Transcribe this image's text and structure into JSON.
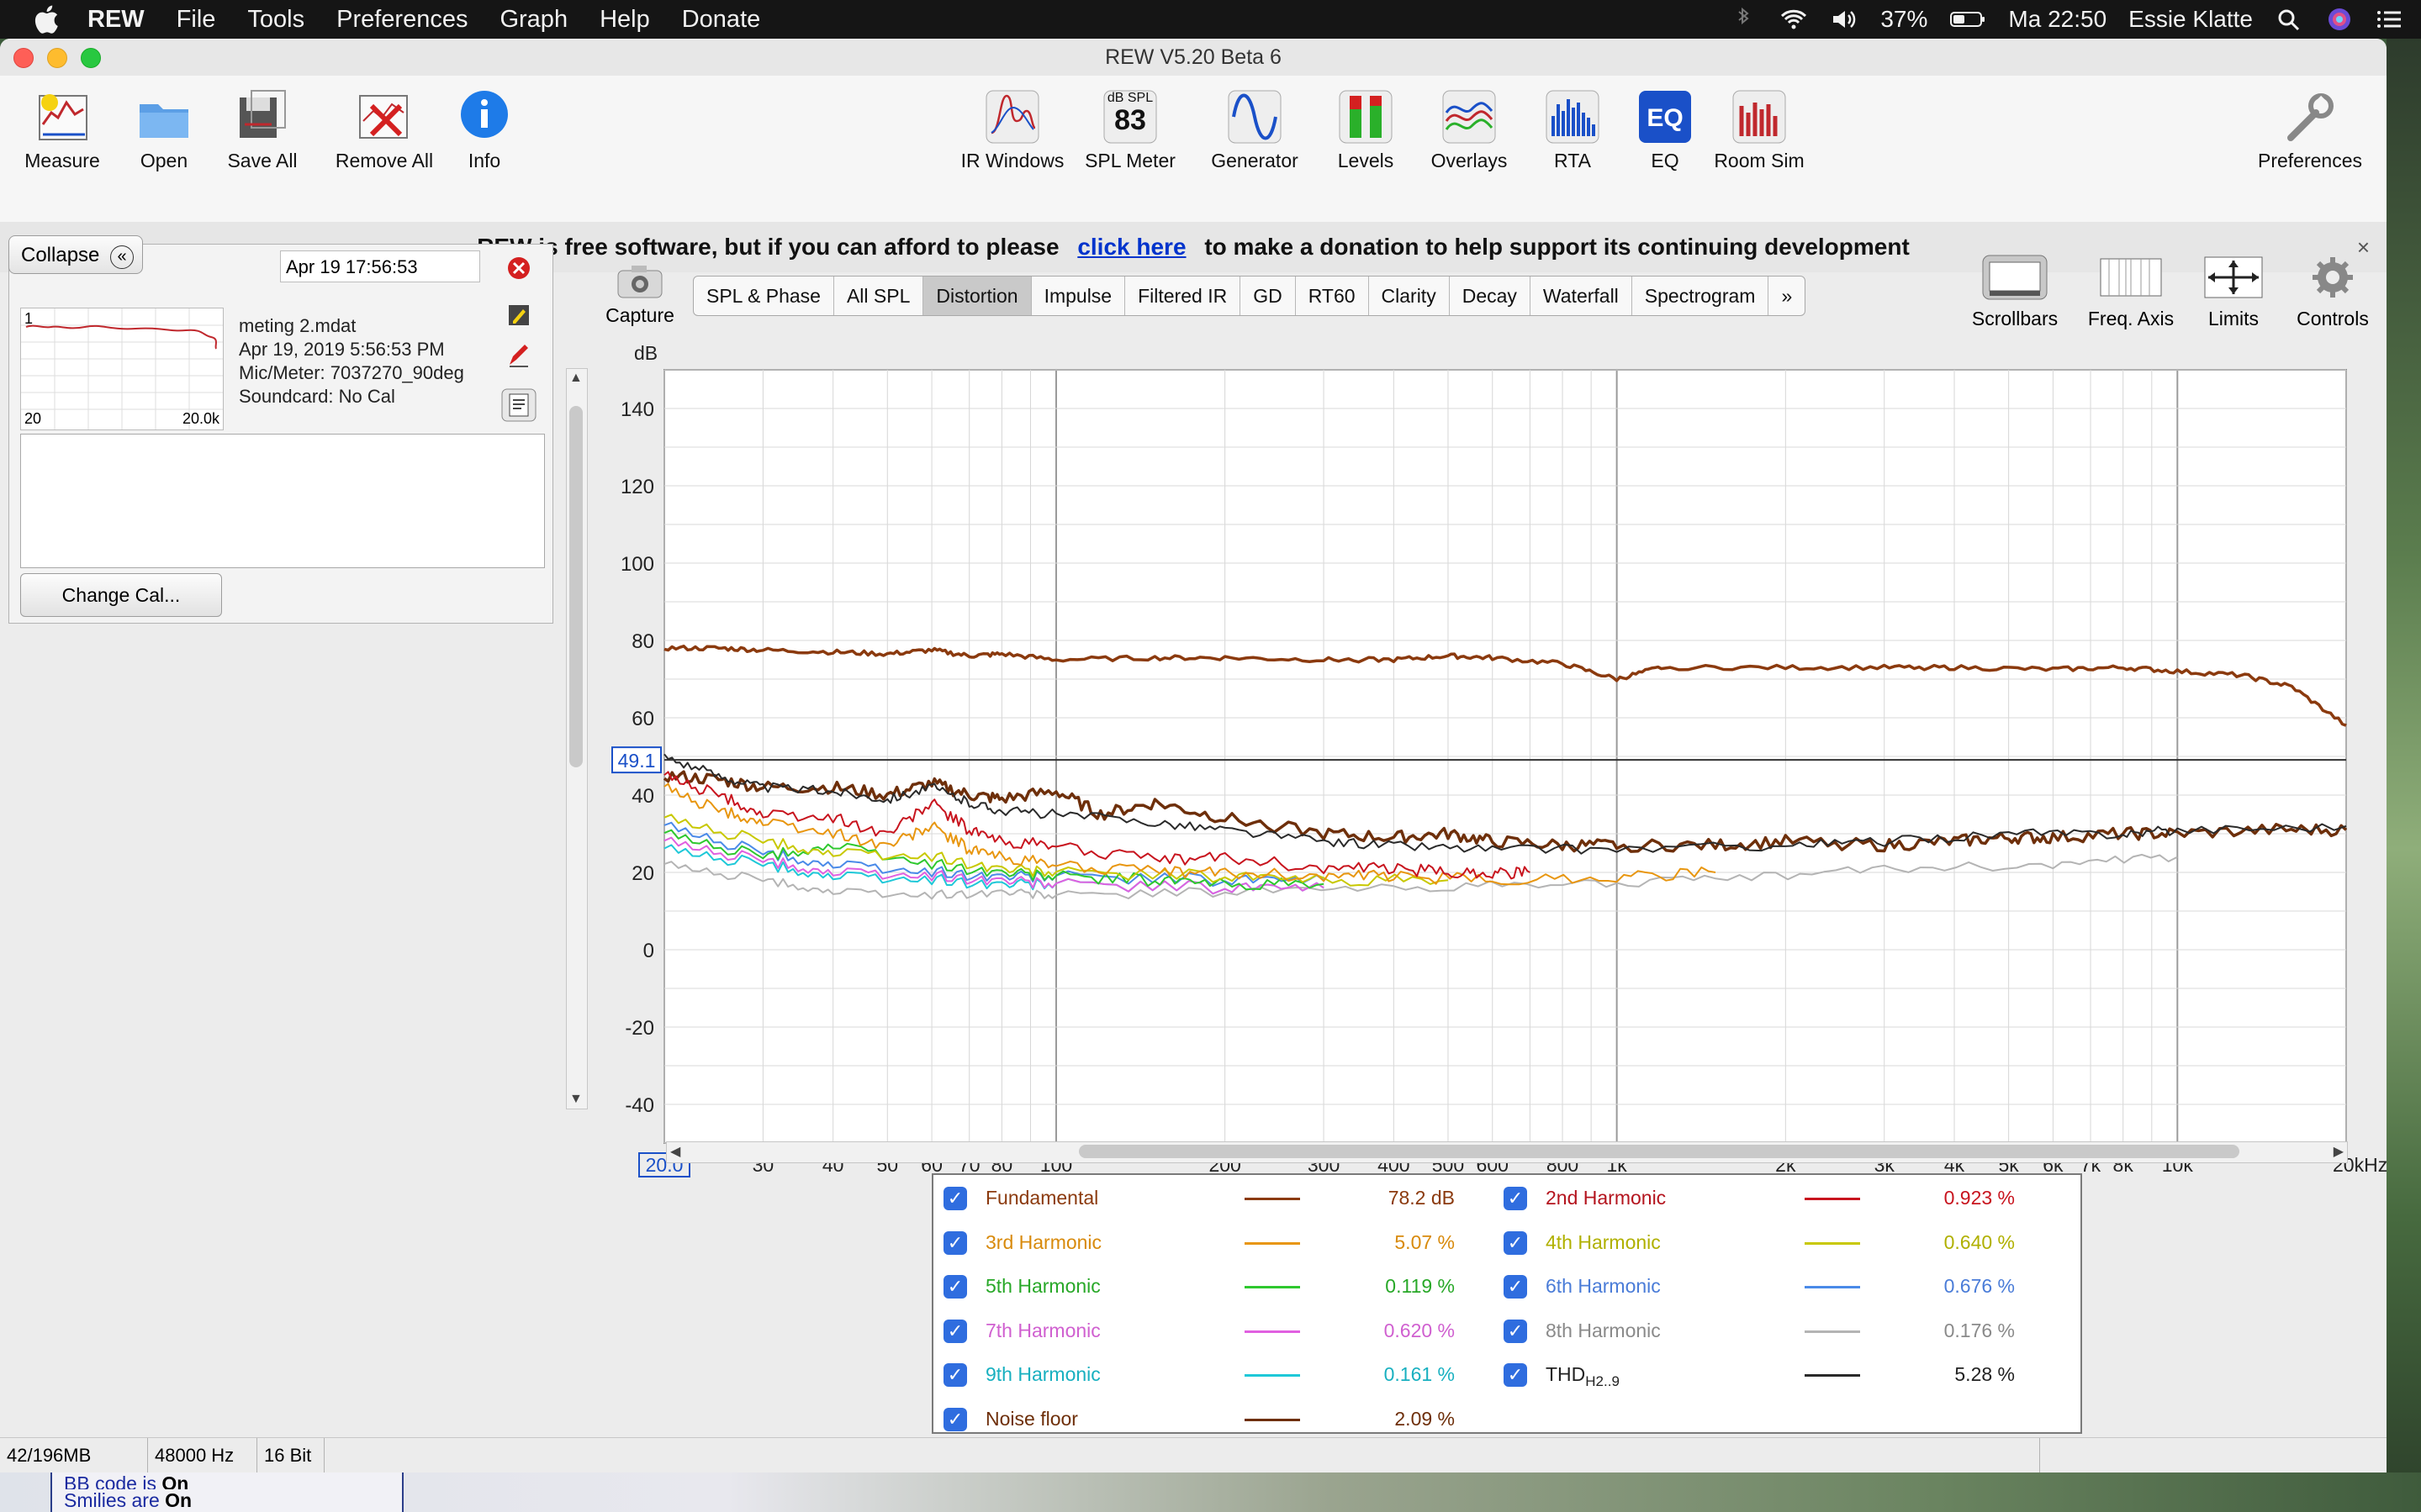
{
  "menubar": {
    "app": "REW",
    "items": [
      "File",
      "Tools",
      "Preferences",
      "Graph",
      "Help",
      "Donate"
    ],
    "battery": "37%",
    "clock": "Ma 22:50",
    "user": "Essie Klatte"
  },
  "window": {
    "title": "REW V5.20 Beta 6"
  },
  "toolbar": {
    "measure": "Measure",
    "open": "Open",
    "save_all": "Save All",
    "remove_all": "Remove All",
    "info": "Info",
    "ir_windows": "IR Windows",
    "spl_meter": "SPL Meter",
    "spl_badge_top": "dB SPL",
    "spl_badge_val": "83",
    "generator": "Generator",
    "levels": "Levels",
    "overlays": "Overlays",
    "rta": "RTA",
    "eq": "EQ",
    "room_sim": "Room Sim",
    "preferences": "Preferences"
  },
  "donate_bar": {
    "before": "REW is free software, but if you can afford to please",
    "link": "click here",
    "after": "to make a donation to help support its continuing development",
    "close": "×"
  },
  "left_panel": {
    "collapse": "Collapse",
    "date_field": "Apr 19 17:56:53",
    "thumb_index": "1",
    "thumb_x_min": "20",
    "thumb_x_max": "20.0k",
    "file": "meting 2.mdat",
    "date": "Apr 19, 2019 5:56:53 PM",
    "mic": "Mic/Meter: 7037270_90deg",
    "soundcard": "Soundcard: No Cal",
    "change_cal": "Change Cal..."
  },
  "graph_tabs": {
    "capture": "Capture",
    "tabs": [
      "SPL & Phase",
      "All SPL",
      "Distortion",
      "Impulse",
      "Filtered IR",
      "GD",
      "RT60",
      "Clarity",
      "Decay",
      "Waterfall",
      "Spectrogram",
      "»"
    ],
    "active": "Distortion",
    "scrollbars": "Scrollbars",
    "freq_axis": "Freq. Axis",
    "limits": "Limits",
    "controls": "Controls"
  },
  "chart_data": {
    "type": "line",
    "ylabel": "dB",
    "xlabel": "",
    "x_scale": "log",
    "xlim": [
      20,
      20000
    ],
    "ylim": [
      -50,
      150
    ],
    "y_ticks": [
      140,
      120,
      100,
      80,
      60,
      40,
      20,
      0,
      -20,
      -40
    ],
    "x_ticks": [
      {
        "v": 20,
        "t": "20.0"
      },
      {
        "v": 30,
        "t": "30"
      },
      {
        "v": 40,
        "t": "40"
      },
      {
        "v": 50,
        "t": "50"
      },
      {
        "v": 60,
        "t": "60"
      },
      {
        "v": 70,
        "t": "70"
      },
      {
        "v": 80,
        "t": "80"
      },
      {
        "v": 100,
        "t": "100"
      },
      {
        "v": 200,
        "t": "200"
      },
      {
        "v": 300,
        "t": "300"
      },
      {
        "v": 400,
        "t": "400"
      },
      {
        "v": 500,
        "t": "500"
      },
      {
        "v": 600,
        "t": "600"
      },
      {
        "v": 800,
        "t": "800"
      },
      {
        "v": 1000,
        "t": "1k"
      },
      {
        "v": 2000,
        "t": "2k"
      },
      {
        "v": 3000,
        "t": "3k"
      },
      {
        "v": 4000,
        "t": "4k"
      },
      {
        "v": 5000,
        "t": "5k"
      },
      {
        "v": 6000,
        "t": "6k"
      },
      {
        "v": 7000,
        "t": "7k"
      },
      {
        "v": 8000,
        "t": "8k"
      },
      {
        "v": 10000,
        "t": "10k"
      },
      {
        "v": 20000,
        "t": "20kHz"
      }
    ],
    "cursor_level": 49.1,
    "cursor_label": "49.1",
    "series": [
      {
        "name": "Fundamental",
        "color": "#8b3a0e",
        "points": [
          [
            20,
            78
          ],
          [
            25,
            78
          ],
          [
            30,
            77.5
          ],
          [
            40,
            77
          ],
          [
            50,
            76.5
          ],
          [
            60,
            77.5
          ],
          [
            70,
            76
          ],
          [
            80,
            76.5
          ],
          [
            100,
            75
          ],
          [
            150,
            75.5
          ],
          [
            200,
            75.5
          ],
          [
            300,
            75
          ],
          [
            400,
            75
          ],
          [
            500,
            76
          ],
          [
            600,
            75.5
          ],
          [
            800,
            74
          ],
          [
            1000,
            70
          ],
          [
            1200,
            73
          ],
          [
            2000,
            73
          ],
          [
            3000,
            73
          ],
          [
            4000,
            73
          ],
          [
            6000,
            72.5
          ],
          [
            8000,
            73
          ],
          [
            10000,
            72
          ],
          [
            13000,
            71
          ],
          [
            16000,
            68
          ],
          [
            20000,
            58
          ]
        ]
      },
      {
        "name": "2nd Harmonic",
        "color": "#c8141e",
        "points": [
          [
            20,
            45
          ],
          [
            25,
            40
          ],
          [
            30,
            35
          ],
          [
            40,
            34
          ],
          [
            50,
            30
          ],
          [
            60,
            38
          ],
          [
            70,
            31
          ],
          [
            80,
            28
          ],
          [
            100,
            27
          ],
          [
            150,
            23
          ],
          [
            200,
            24
          ],
          [
            300,
            21
          ],
          [
            400,
            21
          ],
          [
            500,
            20
          ],
          [
            600,
            20
          ],
          [
            700,
            20
          ]
        ]
      },
      {
        "name": "3rd Harmonic",
        "color": "#e8960f",
        "points": [
          [
            20,
            42
          ],
          [
            25,
            36
          ],
          [
            30,
            33
          ],
          [
            40,
            30
          ],
          [
            50,
            27
          ],
          [
            60,
            32
          ],
          [
            70,
            26
          ],
          [
            80,
            24
          ],
          [
            100,
            22
          ],
          [
            150,
            20
          ],
          [
            200,
            20
          ],
          [
            300,
            19
          ],
          [
            400,
            19
          ],
          [
            600,
            18
          ],
          [
            1000,
            19
          ],
          [
            1500,
            20
          ]
        ]
      },
      {
        "name": "4th Harmonic",
        "color": "#c8c800",
        "points": [
          [
            20,
            34
          ],
          [
            30,
            28
          ],
          [
            40,
            25
          ],
          [
            60,
            24
          ],
          [
            80,
            21
          ],
          [
            100,
            20
          ],
          [
            200,
            19
          ],
          [
            300,
            18
          ],
          [
            500,
            18
          ]
        ]
      },
      {
        "name": "5th Harmonic",
        "color": "#2ec82e",
        "points": [
          [
            20,
            30
          ],
          [
            30,
            24
          ],
          [
            40,
            27
          ],
          [
            60,
            22
          ],
          [
            80,
            20
          ],
          [
            100,
            19
          ],
          [
            150,
            18
          ],
          [
            200,
            17
          ],
          [
            300,
            17
          ]
        ]
      },
      {
        "name": "6th Harmonic",
        "color": "#4a8ae8",
        "points": [
          [
            20,
            32
          ],
          [
            30,
            25
          ],
          [
            40,
            22
          ],
          [
            60,
            20
          ],
          [
            80,
            19
          ],
          [
            100,
            19
          ],
          [
            200,
            18
          ],
          [
            300,
            18
          ]
        ]
      },
      {
        "name": "7th Harmonic",
        "color": "#e060e0",
        "points": [
          [
            20,
            28
          ],
          [
            30,
            23
          ],
          [
            40,
            20
          ],
          [
            60,
            19
          ],
          [
            80,
            18
          ],
          [
            100,
            17
          ],
          [
            200,
            16
          ],
          [
            300,
            16
          ]
        ]
      },
      {
        "name": "8th Harmonic",
        "color": "#b4b4b4",
        "points": [
          [
            20,
            22
          ],
          [
            30,
            18
          ],
          [
            40,
            15
          ],
          [
            60,
            14
          ],
          [
            80,
            15
          ],
          [
            100,
            14
          ],
          [
            200,
            15
          ],
          [
            400,
            16
          ],
          [
            800,
            17
          ],
          [
            1500,
            18
          ],
          [
            3000,
            21
          ],
          [
            6000,
            22
          ],
          [
            10000,
            24
          ]
        ]
      },
      {
        "name": "9th Harmonic",
        "color": "#1ec8d8",
        "points": [
          [
            20,
            26
          ],
          [
            30,
            22
          ],
          [
            40,
            19
          ],
          [
            60,
            18
          ],
          [
            80,
            17
          ],
          [
            100,
            17
          ],
          [
            200,
            16
          ],
          [
            300,
            16
          ]
        ]
      },
      {
        "name": "THD H2..9",
        "color": "#2a2a2a",
        "points": [
          [
            20,
            50
          ],
          [
            25,
            45
          ],
          [
            30,
            42
          ],
          [
            40,
            41
          ],
          [
            50,
            39
          ],
          [
            60,
            42
          ],
          [
            70,
            38
          ],
          [
            80,
            36
          ],
          [
            100,
            35
          ],
          [
            150,
            33
          ],
          [
            200,
            31
          ],
          [
            300,
            28
          ],
          [
            400,
            27
          ],
          [
            600,
            26
          ],
          [
            1000,
            26
          ],
          [
            2000,
            27
          ],
          [
            3000,
            28
          ],
          [
            5000,
            30
          ],
          [
            8000,
            30
          ],
          [
            10000,
            31
          ],
          [
            20000,
            32
          ]
        ]
      },
      {
        "name": "Noise floor",
        "color": "#6e2f0a",
        "points": [
          [
            20,
            45
          ],
          [
            25,
            44
          ],
          [
            30,
            42
          ],
          [
            40,
            42
          ],
          [
            50,
            40
          ],
          [
            60,
            43
          ],
          [
            70,
            40
          ],
          [
            80,
            39
          ],
          [
            100,
            41
          ],
          [
            120,
            35
          ],
          [
            150,
            38
          ],
          [
            200,
            34
          ],
          [
            300,
            30
          ],
          [
            400,
            29
          ],
          [
            500,
            30
          ],
          [
            600,
            28
          ],
          [
            800,
            27
          ],
          [
            1000,
            27
          ],
          [
            1500,
            27
          ],
          [
            2000,
            28
          ],
          [
            3000,
            27
          ],
          [
            4000,
            28
          ],
          [
            5000,
            29
          ],
          [
            6000,
            29
          ],
          [
            8000,
            30
          ],
          [
            10000,
            30
          ],
          [
            15000,
            31
          ],
          [
            20000,
            31
          ]
        ]
      }
    ]
  },
  "legend": [
    {
      "name": "Fundamental",
      "value": "78.2 dB",
      "color": "#8b3a0e",
      "name_color": "#8b3a0e",
      "val_color": "#8b3a0e"
    },
    {
      "name": "2nd Harmonic",
      "value": "0.923 %",
      "color": "#c8141e",
      "name_color": "#b4141e",
      "val_color": "#c8141e"
    },
    {
      "name": "3rd Harmonic",
      "value": "5.07 %",
      "color": "#e8960f",
      "name_color": "#d88a0c",
      "val_color": "#d88a0c"
    },
    {
      "name": "4th Harmonic",
      "value": "0.640 %",
      "color": "#c8c800",
      "name_color": "#b0b000",
      "val_color": "#b0b000"
    },
    {
      "name": "5th Harmonic",
      "value": "0.119 %",
      "color": "#2ec82e",
      "name_color": "#28a828",
      "val_color": "#28a828"
    },
    {
      "name": "6th Harmonic",
      "value": "0.676 %",
      "color": "#4a8ae8",
      "name_color": "#4a7cd8",
      "val_color": "#4a7cd8"
    },
    {
      "name": "7th Harmonic",
      "value": "0.620 %",
      "color": "#e060e0",
      "name_color": "#d060d0",
      "val_color": "#d060d0"
    },
    {
      "name": "8th Harmonic",
      "value": "0.176 %",
      "color": "#b4b4b4",
      "name_color": "#8a8a8a",
      "val_color": "#8a8a8a"
    },
    {
      "name": "9th Harmonic",
      "value": "0.161 %",
      "color": "#1ec8d8",
      "name_color": "#18b0c0",
      "val_color": "#18b0c0"
    },
    {
      "name": "THD",
      "name_sub": "H2..9",
      "value": "5.28 %",
      "color": "#2a2a2a",
      "name_color": "#222222",
      "val_color": "#222222"
    },
    {
      "name": "Noise floor",
      "value": "2.09 %",
      "color": "#6e2f0a",
      "name_color": "#6e2f0a",
      "val_color": "#6e2f0a"
    }
  ],
  "statusbar": {
    "memory": "42/196MB",
    "rate": "48000 Hz",
    "bits": "16 Bit"
  },
  "background": {
    "forum_line1": "BB code",
    "forum_is": "is",
    "forum_on1": "On",
    "forum_line2": "Smilies",
    "forum_are": "are",
    "forum_on2": "On"
  }
}
